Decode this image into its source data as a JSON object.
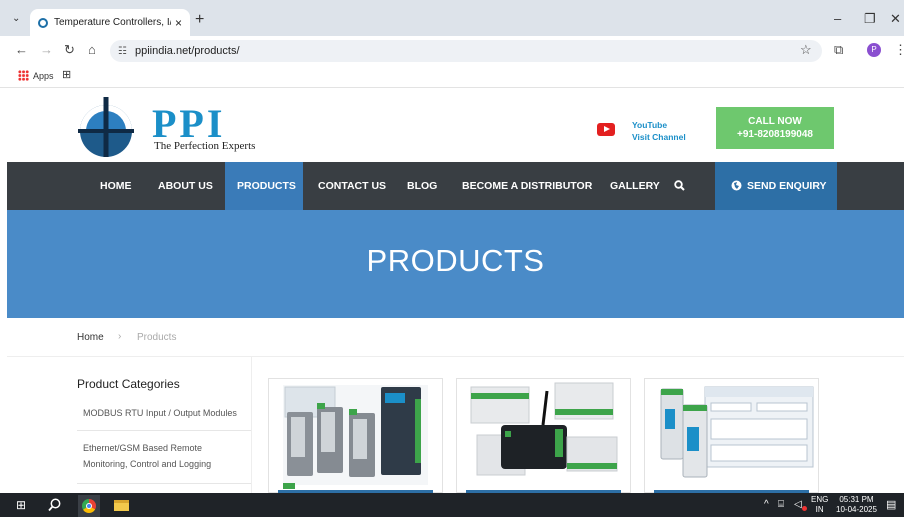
{
  "browser": {
    "tab_title": "Temperature Controllers, I/O M",
    "tab_close": "×",
    "new_tab": "+",
    "url": "ppiindia.net/products/",
    "bookmarks": {
      "apps_label": "Apps"
    },
    "profile_initial": "P",
    "controls": {
      "minimize": "–",
      "maximize": "❐",
      "close": "✕"
    }
  },
  "site": {
    "logo_text": "PPI",
    "tagline": "The Perfection Experts",
    "youtube": {
      "line1": "YouTube",
      "line2": "Visit Channel"
    },
    "call": {
      "line1": "CALL NOW",
      "line2": "+91-8208199048"
    },
    "nav": {
      "items": [
        "HOME",
        "ABOUT US",
        "PRODUCTS",
        "CONTACT US",
        "BLOG",
        "BECOME A DISTRIBUTOR",
        "GALLERY"
      ],
      "active": "PRODUCTS",
      "enquiry": "SEND ENQUIRY"
    },
    "banner_title": "PRODUCTS",
    "breadcrumb": {
      "home": "Home",
      "separator": "›",
      "current": "Products"
    },
    "sidebar": {
      "title": "Product Categories",
      "items": [
        "MODBUS RTU Input / Output Modules",
        "Ethernet/GSM Based Remote Monitoring, Control and Logging"
      ]
    }
  },
  "taskbar": {
    "lang1": "ENG",
    "lang2": "IN",
    "time": "05:31 PM",
    "date": "10-04-2025"
  },
  "colors": {
    "nav_bg": "#393e43",
    "nav_active": "#3a7bb8",
    "banner": "#4a8bc8",
    "call_bg": "#6ec86e",
    "brand_blue": "#1b8fc8"
  }
}
